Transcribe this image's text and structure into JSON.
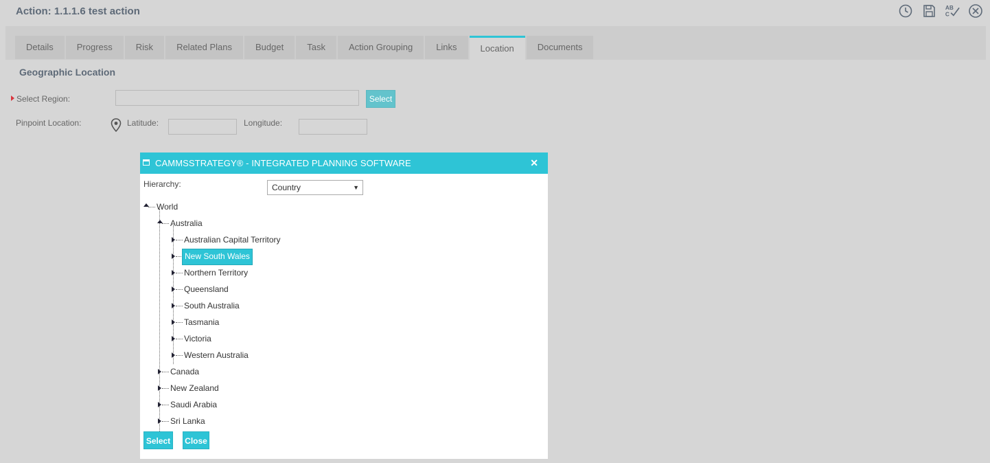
{
  "header": {
    "title": "Action: 1.1.1.6 test action",
    "icons": [
      "history-icon",
      "save-icon",
      "spellcheck-icon",
      "close-icon"
    ]
  },
  "tabs": [
    {
      "label": "Details"
    },
    {
      "label": "Progress"
    },
    {
      "label": "Risk"
    },
    {
      "label": "Related Plans"
    },
    {
      "label": "Budget"
    },
    {
      "label": "Task"
    },
    {
      "label": "Action Grouping"
    },
    {
      "label": "Links"
    },
    {
      "label": "Location",
      "active": true
    },
    {
      "label": "Documents"
    }
  ],
  "location": {
    "section_title": "Geographic Location",
    "select_region_label": "Select Region:",
    "select_region_value": "",
    "select_button": "Select",
    "pinpoint_label": "Pinpoint Location:",
    "latitude_label": "Latitude:",
    "latitude_value": "",
    "longitude_label": "Longitude:",
    "longitude_value": ""
  },
  "modal": {
    "title": "CAMMSSTRATEGY® - INTEGRATED PLANNING SOFTWARE",
    "close_glyph": "✕",
    "hierarchy_label": "Hierarchy:",
    "hierarchy_value": "Country",
    "tree": {
      "root": "World",
      "country": "Australia",
      "states": [
        "Australian Capital Territory",
        "New South Wales",
        "Northern Territory",
        "Queensland",
        "South Australia",
        "Tasmania",
        "Victoria",
        "Western Australia"
      ],
      "selected": "New South Wales",
      "other_countries": [
        "Canada",
        "New Zealand",
        "Saudi Arabia",
        "Sri Lanka"
      ]
    },
    "select_button": "Select",
    "close_button": "Close"
  },
  "colors": {
    "accent": "#2ec4d6",
    "background": "#d6d6d6",
    "required": "#d9363e"
  }
}
